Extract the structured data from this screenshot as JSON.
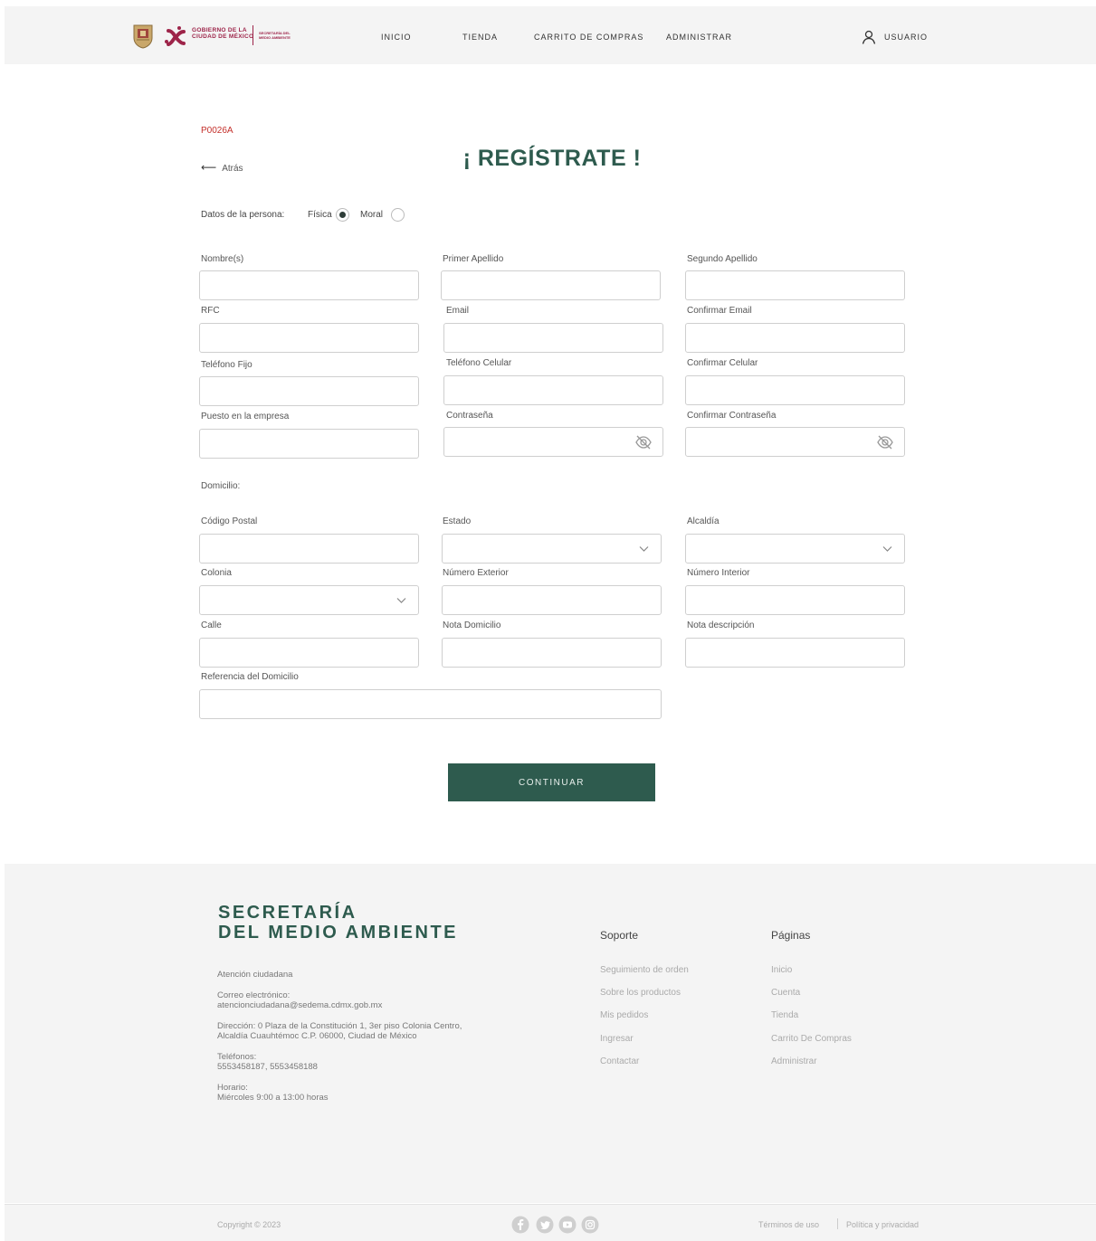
{
  "header": {
    "gov_line1": "GOBIERNO DE LA",
    "gov_line2": "CIUDAD DE MÉXICO",
    "sedema_line1": "SECRETARÍA DEL",
    "sedema_line2": "MEDIO AMBIENTE",
    "nav": [
      "INICIO",
      "TIENDA",
      "CARRITO DE COMPRAS",
      "ADMINISTRAR"
    ],
    "user_label": "USUARIO"
  },
  "page": {
    "code": "P0026A",
    "back_label": "Atrás",
    "title": "¡ REGÍSTRATE !"
  },
  "persona": {
    "label": "Datos de la persona:",
    "options": [
      "Física",
      "Moral"
    ],
    "selected": "Física"
  },
  "fields": {
    "nombre": "Nombre(s)",
    "primer_apellido": "Primer Apellido",
    "segundo_apellido": "Segundo Apellido",
    "rfc": "RFC",
    "email": "Email",
    "confirmar_email": "Confirmar Email",
    "telefono_fijo": "Teléfono Fijo",
    "telefono_celular": "Teléfono Celular",
    "confirmar_celular": "Confirmar Celular",
    "puesto": "Puesto en la empresa",
    "contrasena": "Contraseña",
    "confirmar_contrasena": "Confirmar Contraseña"
  },
  "domicilio": {
    "section_label": "Domicilio:",
    "codigo_postal": "Código Postal",
    "estado": "Estado",
    "alcaldia": "Alcaldía",
    "colonia": "Colonia",
    "numero_exterior": "Número Exterior",
    "numero_interior": "Número Interior",
    "calle": "Calle",
    "nota_domicilio": "Nota Domicilio",
    "nota_descripcion": "Nota descripción",
    "referencia": "Referencia del Domicilio"
  },
  "continue_label": "CONTINUAR",
  "footer": {
    "brand_line1": "SECRETARÍA",
    "brand_line2": "DEL MEDIO AMBIENTE",
    "atencion": "Atención ciudadana",
    "correo_label": "Correo electrónico:",
    "correo": "atencionciudadana@sedema.cdmx.gob.mx",
    "direccion_line1": "Dirección: 0 Plaza de la Constitución 1, 3er piso Colonia Centro,",
    "direccion_line2": "Alcaldía Cuauhtémoc C.P. 06000, Ciudad de México",
    "telefonos_label": "Teléfonos:",
    "telefonos": "5553458187, 5553458188",
    "horario_label": "Horario:",
    "horario": "Miércoles 9:00 a 13:00 horas",
    "soporte_title": "Soporte",
    "soporte_links": [
      "Seguimiento de orden",
      "Sobre los productos",
      "Mis pedidos",
      "Ingresar",
      "Contactar"
    ],
    "paginas_title": "Páginas",
    "paginas_links": [
      "Inicio",
      "Cuenta",
      "Tienda",
      "Carrito De Compras",
      "Administrar"
    ],
    "copyright": "Copyright © 2023",
    "terminos": "Términos de uso",
    "privacidad": "Política y privacidad",
    "social_icons": [
      "facebook-icon",
      "twitter-icon",
      "youtube-icon",
      "instagram-icon"
    ]
  },
  "colors": {
    "accent": "#2e5b4e",
    "brand_red": "#9d2449",
    "code_red": "#c4302b"
  }
}
